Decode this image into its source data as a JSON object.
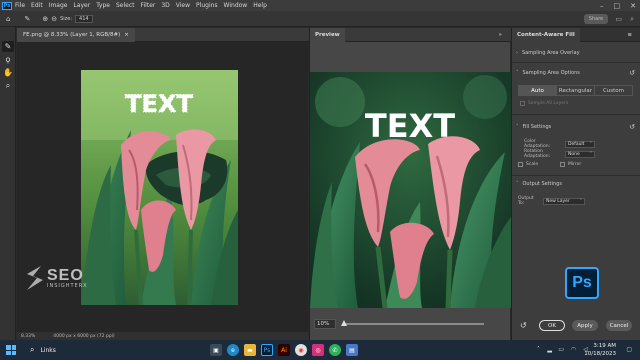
{
  "menubar": {
    "logo": "Ps",
    "items": [
      "File",
      "Edit",
      "Image",
      "Layer",
      "Type",
      "Select",
      "Filter",
      "3D",
      "View",
      "Plugins",
      "Window",
      "Help"
    ]
  },
  "optionsbar": {
    "size_label": "Size:",
    "size_value": "414",
    "share_label": "Share"
  },
  "document": {
    "tab_title": "FE.png @ 8.33% (Layer 1, RGB/8#)",
    "tab_close": "×",
    "image_text": "TEXT",
    "zoom": "8.33%",
    "dimensions": "4000 px x 6000 px (72 ppi)"
  },
  "preview": {
    "tab_label": "Preview",
    "image_text": "TEXT",
    "zoom_value": "10%",
    "zoom_slider_fraction": 0.0
  },
  "content_aware_fill": {
    "tab_label": "Content-Aware Fill",
    "sampling_overlay": "Sampling Area Overlay",
    "sampling_options": "Sampling Area Options",
    "sampling_modes": [
      "Auto",
      "Rectangular",
      "Custom"
    ],
    "selected_mode": "Auto",
    "sample_all_layers": "Sample All Layers",
    "fill_settings": "Fill Settings",
    "color_adaptation_label": "Color Adaptation:",
    "color_adaptation_value": "Default",
    "rotation_adaptation_label": "Rotation Adaptation:",
    "rotation_adaptation_value": "None",
    "scale_label": "Scale",
    "mirror_label": "Mirror",
    "output_settings": "Output Settings",
    "output_to_label": "Output To:",
    "output_to_value": "New Layer",
    "ok": "OK",
    "apply": "Apply",
    "cancel": "Cancel"
  },
  "taskbar": {
    "search_text": "Links",
    "time": "3:19 AM",
    "date": "10/18/2023"
  },
  "watermarks": {
    "seo_line1": "SEO",
    "seo_line2": "INSIGHTERX",
    "ps_badge": "Ps"
  },
  "colors": {
    "ps_blue": "#31a8ff",
    "ps_navy": "#001e36",
    "panel": "#3d3d3d",
    "canvas": "#262626"
  }
}
